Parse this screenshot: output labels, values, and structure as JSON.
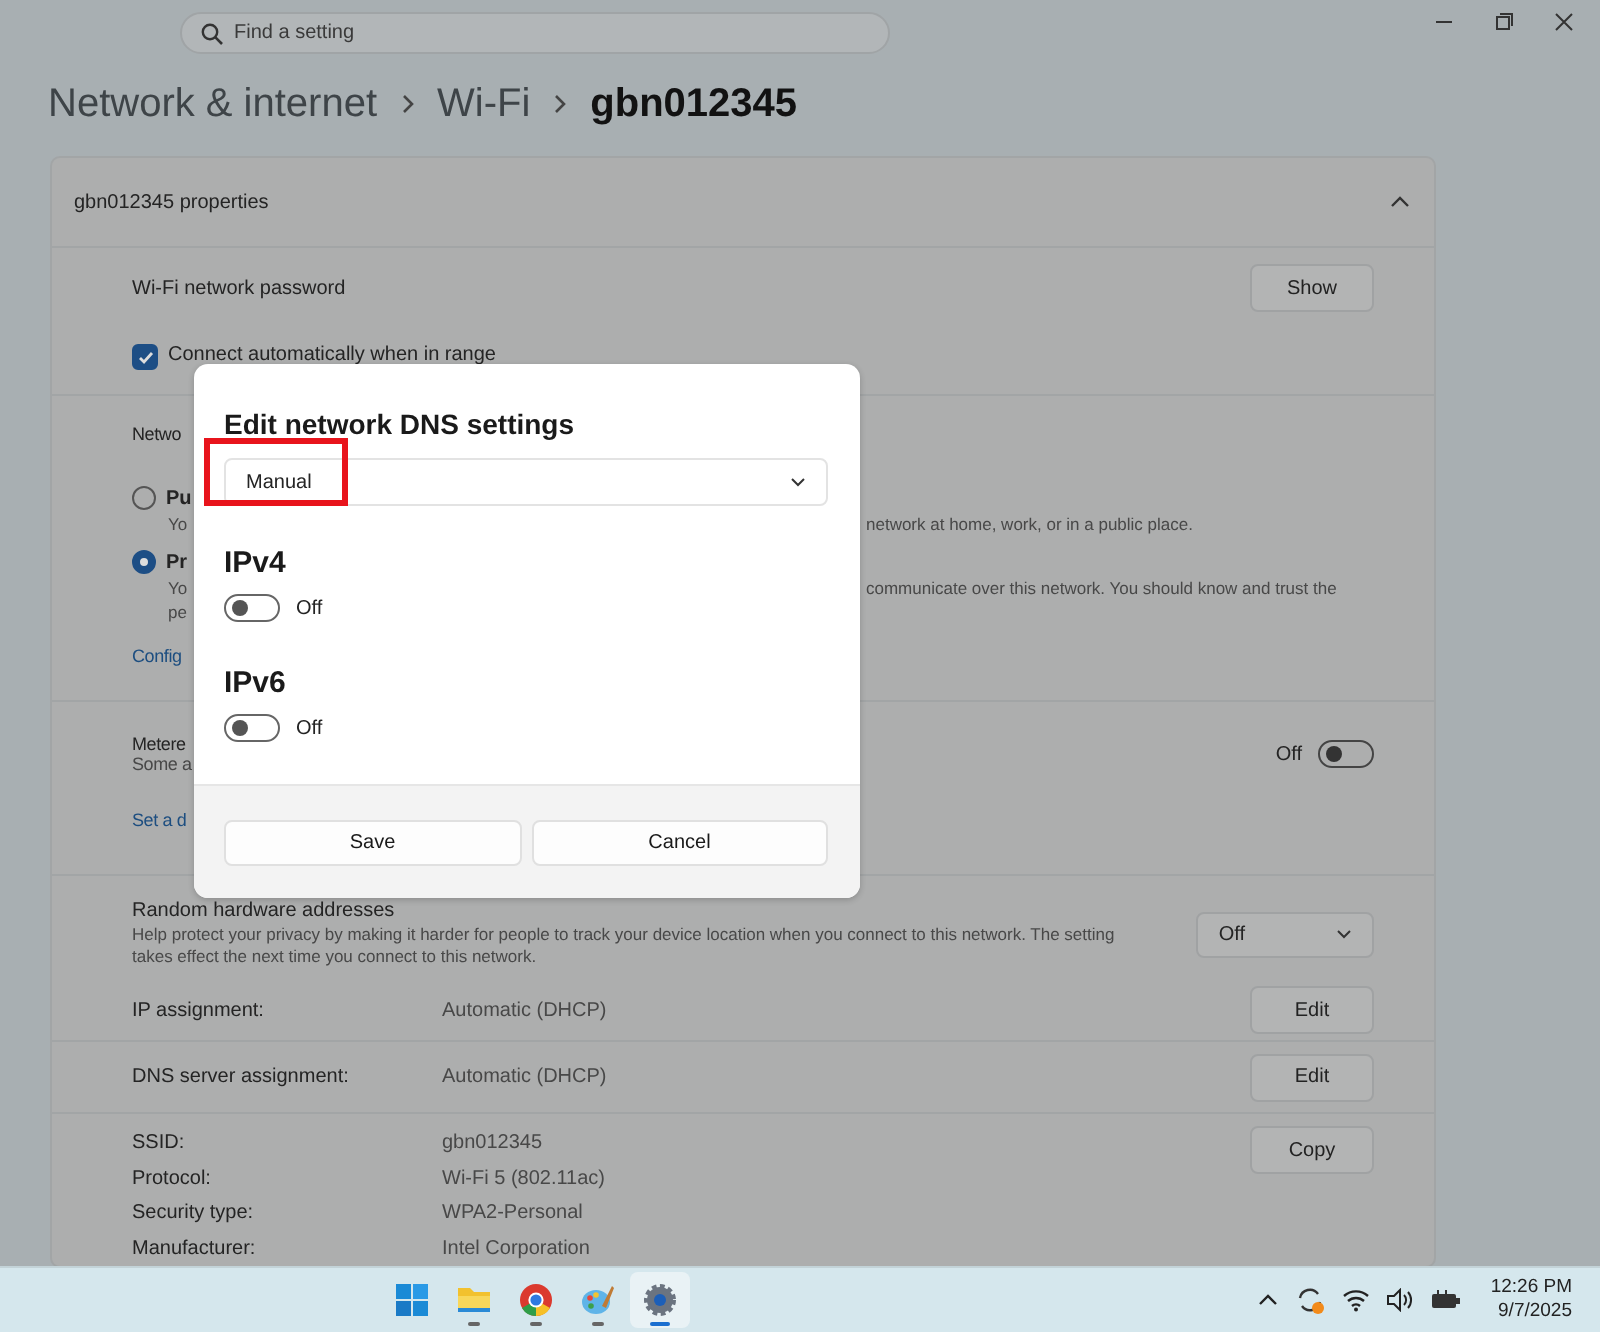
{
  "search": {
    "placeholder": "Find a setting"
  },
  "breadcrumb": [
    {
      "label": "Network & internet",
      "current": false
    },
    {
      "label": "Wi-Fi",
      "current": false
    },
    {
      "label": "gbn012345",
      "current": true
    }
  ],
  "properties": {
    "title": "gbn012345 properties",
    "expanded": true,
    "password": {
      "label": "Wi-Fi network password",
      "button": "Show"
    },
    "auto_connect": {
      "label": "Connect automatically when in range",
      "checked": true
    },
    "profile": {
      "heading": "Netwo",
      "options": [
        {
          "label": "Pu",
          "lines": [
            {
              "left": "Yo",
              "right": "network at home, work, or in a public place."
            }
          ],
          "selected": false
        },
        {
          "label": "Pr",
          "lines": [
            {
              "left": "Yo",
              "right": "communicate over this network. You should know and trust the"
            },
            {
              "left": "pe"
            }
          ],
          "selected": true
        }
      ],
      "link": "Config"
    },
    "metered": {
      "label": "Metere",
      "description": "Some a",
      "state_text": "Off",
      "on": false,
      "link": "Set a d"
    },
    "random_hw": {
      "label": "Random hardware addresses",
      "description": "Help protect your privacy by making it harder for people to track your device location when you connect to this network. The setting takes effect the next time you connect to this network.",
      "value": "Off"
    },
    "assignments": [
      {
        "label": "IP assignment:",
        "value": "Automatic (DHCP)",
        "button": "Edit"
      },
      {
        "label": "DNS server assignment:",
        "value": "Automatic (DHCP)",
        "button": "Edit"
      }
    ],
    "details": [
      {
        "label": "SSID:",
        "value": "gbn012345"
      },
      {
        "label": "Protocol:",
        "value": "Wi-Fi 5 (802.11ac)"
      },
      {
        "label": "Security type:",
        "value": "WPA2-Personal"
      },
      {
        "label": "Manufacturer:",
        "value": "Intel Corporation"
      }
    ],
    "copy_button": "Copy"
  },
  "dialog": {
    "title": "Edit network DNS settings",
    "dropdown": {
      "value": "Manual",
      "highlighted": true
    },
    "sections": [
      {
        "label": "IPv4",
        "on": false,
        "state_text": "Off"
      },
      {
        "label": "IPv6",
        "on": false,
        "state_text": "Off"
      }
    ],
    "buttons": [
      {
        "label": "Save"
      },
      {
        "label": "Cancel"
      }
    ]
  },
  "taskbar": {
    "apps": [
      {
        "kind": "start",
        "running": false,
        "selected": false
      },
      {
        "kind": "files",
        "running": true,
        "selected": false
      },
      {
        "kind": "browser",
        "running": true,
        "selected": false
      },
      {
        "kind": "paint",
        "running": true,
        "selected": false
      },
      {
        "kind": "settings",
        "running": true,
        "selected": true
      }
    ],
    "time": "12:26 PM",
    "date": "9/7/2025"
  }
}
